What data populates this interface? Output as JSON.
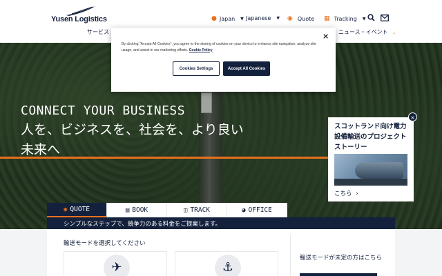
{
  "brand": {
    "name": "Yusen Logistics"
  },
  "utility_nav": {
    "region": "Japan",
    "language": "Japanese",
    "quote": "Quote",
    "tracking": "Tracking"
  },
  "main_nav": {
    "services": "サービス",
    "news_events": "ニュース・イベント"
  },
  "hero": {
    "headline_en": "CONNECT YOUR BUSINESS",
    "headline_jp_1": "人を、ビジネスを、社会を、より良い",
    "headline_jp_2": "未来へ"
  },
  "story_card": {
    "title": "スコットランド向け電力設備輸送のプロジェクトストーリー",
    "link": "こちら",
    "close": "×"
  },
  "tabs": [
    {
      "label": "QUOTE",
      "icon": "quote-icon"
    },
    {
      "label": "BOOK",
      "icon": "book-icon"
    },
    {
      "label": "TRACK",
      "icon": "map-icon"
    },
    {
      "label": "OFFICE",
      "icon": "globe-icon"
    }
  ],
  "tab_content": {
    "description": "シンプルなステップで、競争力のある料金をご提案します。",
    "select_mode_label": "輸送モードを選択してください",
    "modes": [
      {
        "icon": "airplane-icon"
      },
      {
        "icon": "ship-icon"
      }
    ],
    "undecided_label": "輸送モードが未定の方はこちら"
  },
  "cookie_banner": {
    "text": "By clicking “Accept All Cookies”, you agree to the storing of cookies on your device to enhance site navigation, analyze site usage, and assist in our marketing efforts.",
    "policy_link": "Cookie Policy",
    "settings_button": "Cookies Settings",
    "accept_button": "Accept All Cookies",
    "close": "×"
  },
  "colors": {
    "navy": "#14213d",
    "accent_orange": "#e8711c"
  }
}
